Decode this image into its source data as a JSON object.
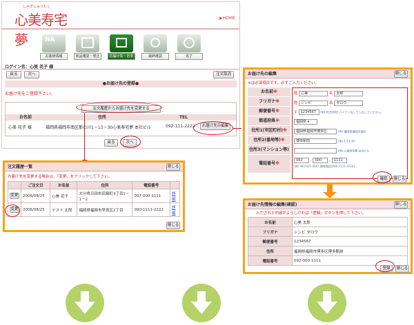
{
  "header": {
    "logo_ruby": "しみずじゅうたく",
    "logo_text": "心美寿宅夢",
    "home_link": "▶HOME"
  },
  "steps": [
    {
      "label": "お客様情報"
    },
    {
      "label": "商品確認・修正"
    },
    {
      "label": "お届け先・お支払"
    },
    {
      "label": "最終確認"
    },
    {
      "label": "完了"
    }
  ],
  "login": {
    "text": "ログイン名：心美 花子 様"
  },
  "main_nav": {
    "back": "戻る",
    "next": "次へ",
    "cancel": "注文取消"
  },
  "main_panel": {
    "title": "●お届け先の登録●",
    "notice": "お届け先をご登録下さい。",
    "history_button": "注文履歴からお届け先を変更する",
    "headers": [
      "お名前",
      "住所",
      "TEL"
    ],
    "row": {
      "name": "心美 花子 様",
      "address": "福岡県福岡市南区那の川1－13－30心美寿宅夢 本社ビル",
      "tel": "092-111-2222",
      "edit_button": "お届け先の編集"
    },
    "back": "戻る",
    "next": "次へ"
  },
  "history_panel": {
    "title": "注文履歴一覧",
    "close": "閉じる",
    "notice": "お届け先を変更する場合は、「変更」をクリックして下さい。",
    "headers": [
      "ご注文日",
      "お名前",
      "住所",
      "電話番号"
    ],
    "rows": [
      {
        "change": "変更",
        "date": "2006/08/25",
        "name": "心美 花子",
        "address": "大分県日田市田島町3丁目1－1－2",
        "tel": "097-000-1111",
        "detail": "詳細"
      },
      {
        "change": "変更",
        "date": "2006/08/25",
        "name": "テスト 太郎",
        "address": "福岡県福岡市早良区2丁目",
        "tel": "090-1111-2222",
        "detail": "詳細"
      }
    ],
    "close_bottom": "閉じる"
  },
  "edit_panel": {
    "title": "お届け先の編集",
    "close": "閉じる",
    "notice": "※は必須項目です。必ずご入力ください。",
    "fields": [
      {
        "label": "お名前",
        "mark": "※"
      },
      {
        "label": "フリガナ",
        "mark": "※"
      },
      {
        "label": "郵便番号",
        "mark": "※"
      },
      {
        "label": "都道府県",
        "mark": "※"
      },
      {
        "label": "住所1(市区町村)",
        "mark": "※"
      },
      {
        "label": "住所2(番地等)",
        "mark": "※"
      },
      {
        "label": "住所3(マンション等)",
        "mark": ""
      },
      {
        "label": "電話番号",
        "mark": "※"
      }
    ],
    "name": {
      "sei_label": "姓",
      "sei": "心美",
      "mei_label": "名",
      "mei": "太郎"
    },
    "kana": {
      "sei_label": "姓",
      "sei": "シンビ",
      "mei_label": "名",
      "mei": "タロウ"
    },
    "zip": {
      "prefix": "〒",
      "value": "1234567",
      "hint": "(例) 8150081 ハイフンなしで入力してください。"
    },
    "pref": {
      "value": "福岡県"
    },
    "addr1": {
      "value": "福岡県福岡市博多区",
      "hint": "(例) 福岡県福岡市南区"
    },
    "addr2": {
      "value": "博多駅前",
      "hint": "(例) 1-13-30"
    },
    "addr3": {
      "value": "",
      "hint": "(例) 心美寿宅夢 本社ビル"
    },
    "tel": {
      "p1": "092",
      "p2": "000",
      "p3": "1111",
      "hint": "(例) 092-621-4567 携帯電話(090-1111-2222)"
    },
    "confirm": "確認",
    "close_bottom": "閉じる"
  },
  "confirm_panel": {
    "title": "お届け先情報の編集(確認)",
    "close": "閉じる",
    "notice": "入力された内容がよろしければ「登録」ボタンを押して下さい。",
    "rows": [
      {
        "label": "お名前",
        "value": "心美 太郎"
      },
      {
        "label": "フリガナ",
        "value": "シンビ タロウ"
      },
      {
        "label": "郵便番号",
        "value": "1234567"
      },
      {
        "label": "住所",
        "value": "福岡県福岡市博多区博多駅前"
      },
      {
        "label": "電話番号",
        "value": "092-000-1111"
      }
    ],
    "register": "登録",
    "close_bottom": "閉じる"
  },
  "colors": {
    "accent_orange": "#f7a21a",
    "highlight_red": "#d0151f",
    "header_pink": "#f6dede",
    "arrow_green": "#b4d267"
  }
}
